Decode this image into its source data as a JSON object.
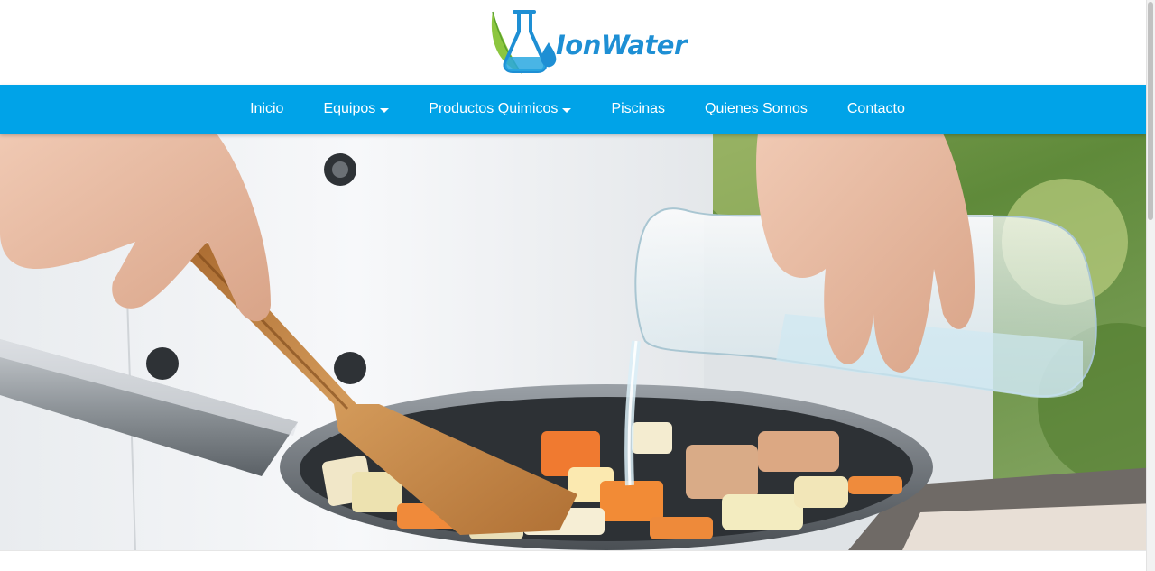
{
  "brand": {
    "name": "IonWater",
    "logo_icon": "flask-leaf-drop-logo",
    "color": "#1e8fd4"
  },
  "nav": {
    "background": "#00a3e8",
    "items": [
      {
        "label": "Inicio",
        "dropdown": false
      },
      {
        "label": "Equipos",
        "dropdown": true
      },
      {
        "label": "Productos Quimicos",
        "dropdown": true
      },
      {
        "label": "Piscinas",
        "dropdown": false
      },
      {
        "label": "Quienes Somos",
        "dropdown": false
      },
      {
        "label": "Contacto",
        "dropdown": false
      }
    ]
  },
  "hero": {
    "image": "chef-pouring-water-into-frying-pan-with-vegetables"
  }
}
